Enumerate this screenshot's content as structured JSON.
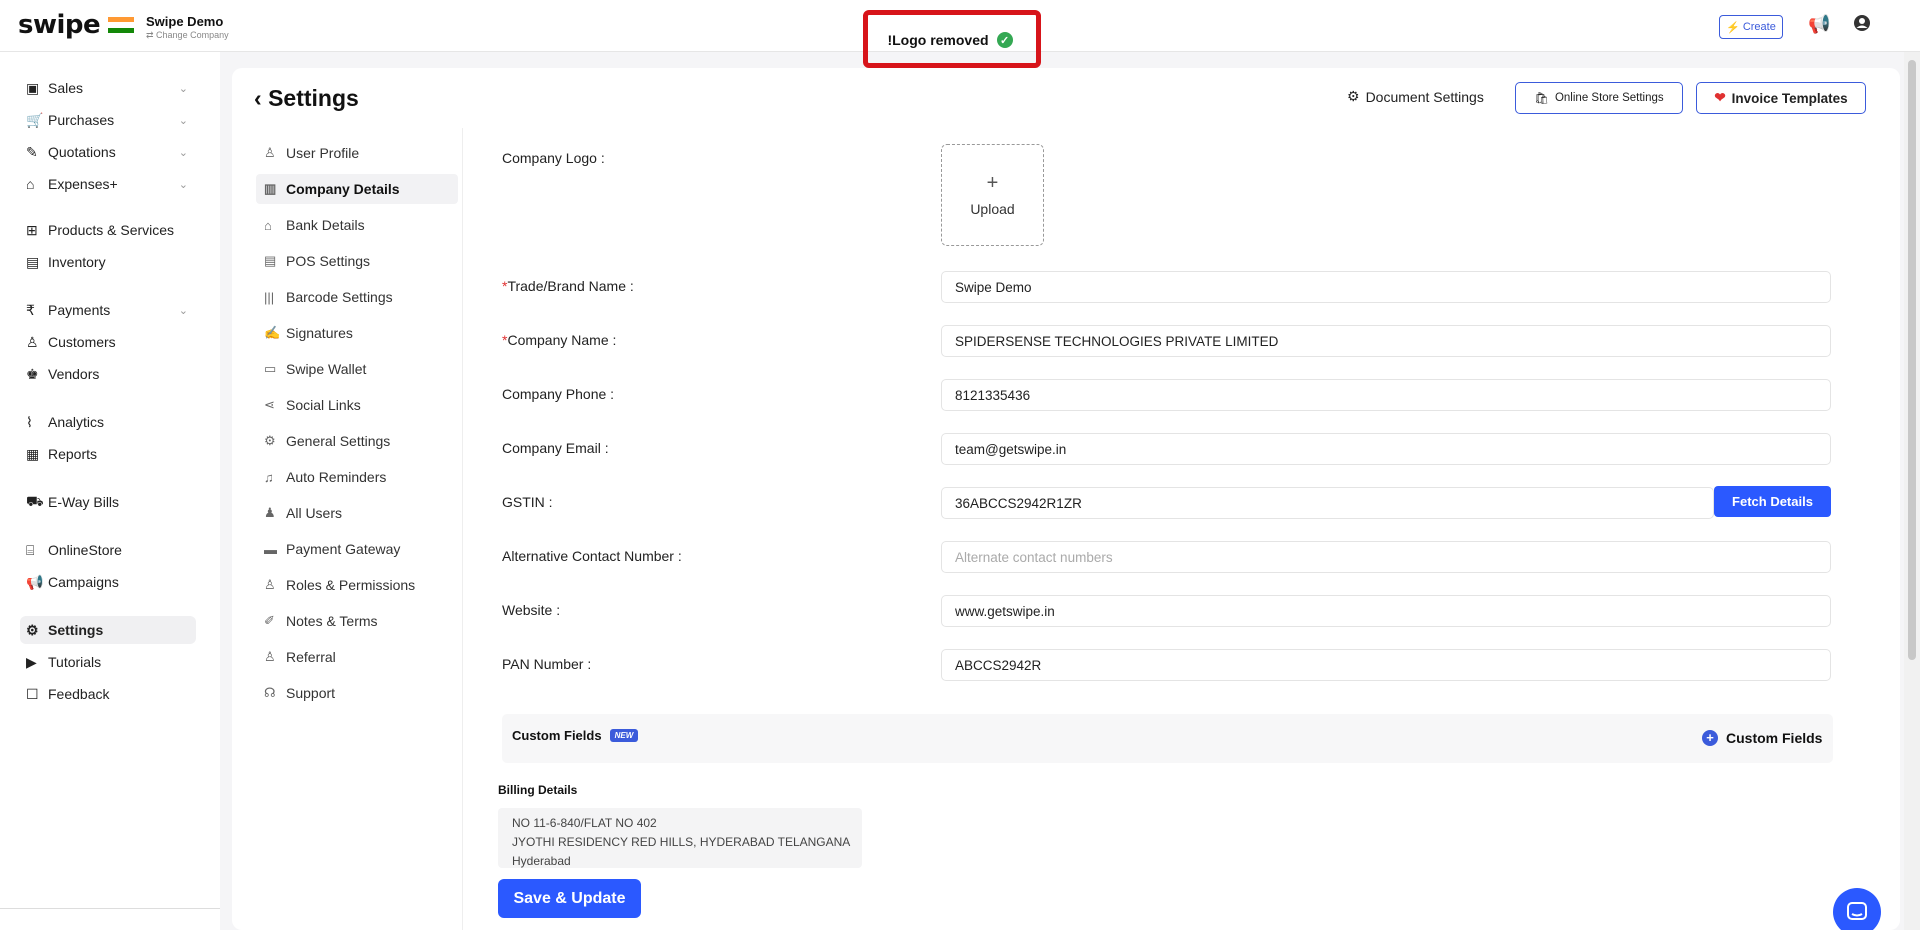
{
  "topbar": {
    "brand": "swipe",
    "company_name": "Swipe Demo",
    "change_company": "⇄ Change Company",
    "toast_text": "!Logo removed",
    "create_label": "Create"
  },
  "sidebar": {
    "items": [
      {
        "label": "Sales",
        "icon": "sales-icon",
        "glyph": "▣",
        "chevron": true
      },
      {
        "label": "Purchases",
        "icon": "cart-icon",
        "glyph": "🛒",
        "chevron": true
      },
      {
        "label": "Quotations",
        "icon": "pen-icon",
        "glyph": "✎",
        "chevron": true
      },
      {
        "label": "Expenses+",
        "icon": "tag-icon",
        "glyph": "⌂",
        "chevron": true
      },
      {
        "label": "Products & Services",
        "icon": "barcode-box-icon",
        "glyph": "⊞",
        "chevron": false
      },
      {
        "label": "Inventory",
        "icon": "warehouse-icon",
        "glyph": "▤",
        "chevron": false
      },
      {
        "label": "Payments",
        "icon": "rupee-icon",
        "glyph": "₹",
        "chevron": true
      },
      {
        "label": "Customers",
        "icon": "user-icon",
        "glyph": "♙",
        "chevron": false
      },
      {
        "label": "Vendors",
        "icon": "users-icon",
        "glyph": "♚",
        "chevron": false
      },
      {
        "label": "Analytics",
        "icon": "chart-icon",
        "glyph": "⌇",
        "chevron": false
      },
      {
        "label": "Reports",
        "icon": "report-icon",
        "glyph": "▦",
        "chevron": false
      },
      {
        "label": "E-Way Bills",
        "icon": "truck-icon",
        "glyph": "⛟",
        "chevron": false
      },
      {
        "label": "OnlineStore",
        "icon": "store-icon",
        "glyph": "⌸",
        "chevron": false
      },
      {
        "label": "Campaigns",
        "icon": "megaphone-icon",
        "glyph": "📢",
        "chevron": false
      },
      {
        "label": "Settings",
        "icon": "gear-icon",
        "glyph": "⚙",
        "chevron": false
      },
      {
        "label": "Tutorials",
        "icon": "youtube-icon",
        "glyph": "▶",
        "chevron": false
      },
      {
        "label": "Feedback",
        "icon": "comment-icon",
        "glyph": "☐",
        "chevron": false
      }
    ]
  },
  "main": {
    "title": "Settings",
    "document_settings": "Document Settings",
    "online_store_settings": "Online Store Settings",
    "invoice_templates": "Invoice Templates",
    "submenu": [
      {
        "label": "User Profile",
        "glyph": "♙"
      },
      {
        "label": "Company Details",
        "glyph": "▥"
      },
      {
        "label": "Bank Details",
        "glyph": "⌂"
      },
      {
        "label": "POS Settings",
        "glyph": "▤"
      },
      {
        "label": "Barcode Settings",
        "glyph": "|||"
      },
      {
        "label": "Signatures",
        "glyph": "✍"
      },
      {
        "label": "Swipe Wallet",
        "glyph": "▭"
      },
      {
        "label": "Social Links",
        "glyph": "⋖"
      },
      {
        "label": "General Settings",
        "glyph": "⚙"
      },
      {
        "label": "Auto Reminders",
        "glyph": "♫"
      },
      {
        "label": "All Users",
        "glyph": "♟"
      },
      {
        "label": "Payment Gateway",
        "glyph": "▬"
      },
      {
        "label": "Roles & Permissions",
        "glyph": "♙"
      },
      {
        "label": "Notes & Terms",
        "glyph": "✐"
      },
      {
        "label": "Referral",
        "glyph": "♙"
      },
      {
        "label": "Support",
        "glyph": "☊"
      }
    ]
  },
  "form": {
    "company_logo_label": "Company Logo",
    "upload_label": "Upload",
    "trade_name_label": "Trade/Brand Name",
    "trade_name_value": "Swipe Demo",
    "company_name_label": "Company Name",
    "company_name_value": "SPIDERSENSE TECHNOLOGIES PRIVATE LIMITED",
    "phone_label": "Company Phone",
    "phone_value": "8121335436",
    "email_label": "Company Email",
    "email_value": "team@getswipe.in",
    "gstin_label": "GSTIN",
    "gstin_value": "36ABCCS2942R1ZR",
    "fetch_label": "Fetch Details",
    "alt_contact_label": "Alternative Contact Number",
    "alt_contact_placeholder": "Alternate contact numbers",
    "website_label": "Website",
    "website_value": "www.getswipe.in",
    "pan_label": "PAN Number",
    "pan_value": "ABCCS2942R",
    "custom_fields_title": "Custom Fields",
    "new_badge": "NEW",
    "custom_fields_add": "Custom Fields",
    "billing_title": "Billing Details",
    "billing_lines": [
      "NO 11-6-840/FLAT NO 402",
      "JYOTHI RESIDENCY RED HILLS, HYDERABAD TELANGANA",
      "Hyderabad"
    ],
    "save_label": "Save & Update"
  }
}
